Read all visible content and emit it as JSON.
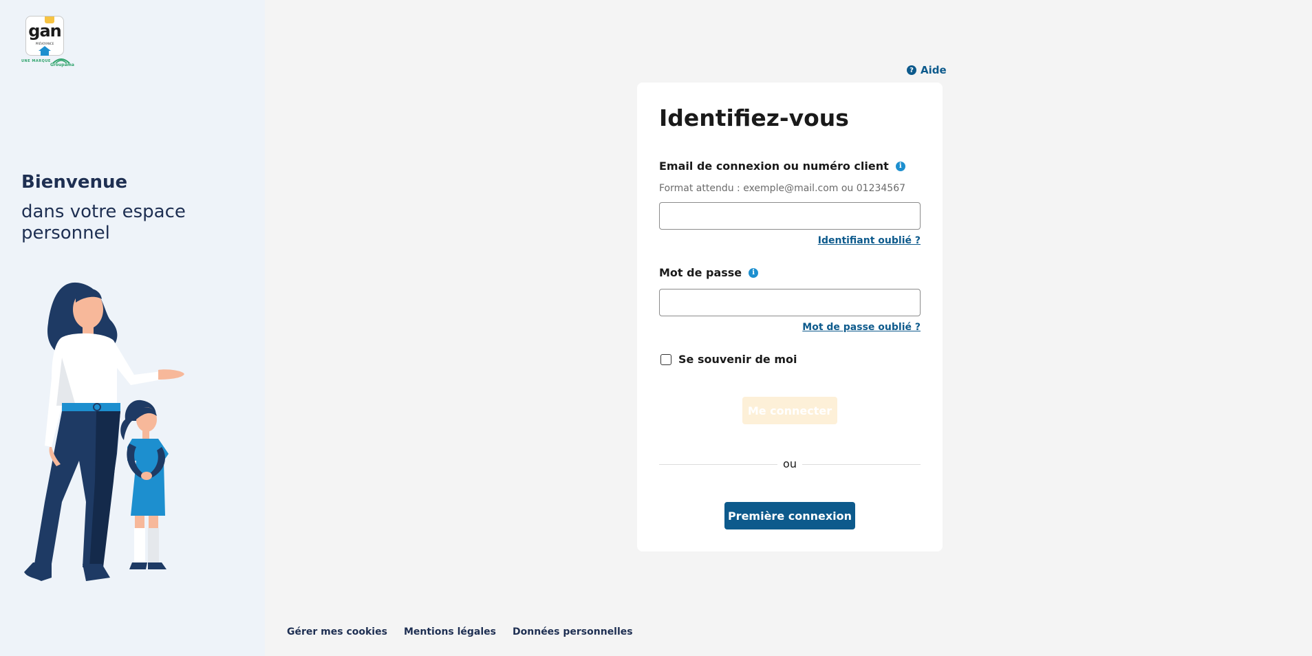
{
  "brand": {
    "logo_text": "gan",
    "logo_sub": "PRÉVOYANCE",
    "brand_line": "UNE MARQUE",
    "group_name": "Groupama"
  },
  "sidebar": {
    "welcome_title": "Bienvenue",
    "welcome_subtitle": "dans votre espace personnel"
  },
  "header": {
    "help_label": "Aide"
  },
  "login": {
    "title": "Identifiez-vous",
    "email_label": "Email de connexion ou numéro client",
    "email_hint": "Format attendu : exemple@mail.com ou 01234567",
    "email_value": "",
    "forgot_id": "Identifiant oublié ?",
    "password_label": "Mot de passe",
    "password_value": "",
    "forgot_password": "Mot de passe oublié ?",
    "remember_label": "Se souvenir de moi",
    "remember_checked": false,
    "login_button": "Me connecter",
    "or_text": "ou",
    "first_login_button": "Première connexion"
  },
  "footer": {
    "links": [
      "Gérer mes cookies",
      "Mentions légales",
      "Données personnelles"
    ]
  },
  "colors": {
    "primary": "#0d5a8c",
    "info": "#1d8fcf",
    "disabled_button": "#fdf0d8",
    "sidebar_bg": "#eef3f9",
    "text_dark": "#1e2f52"
  }
}
